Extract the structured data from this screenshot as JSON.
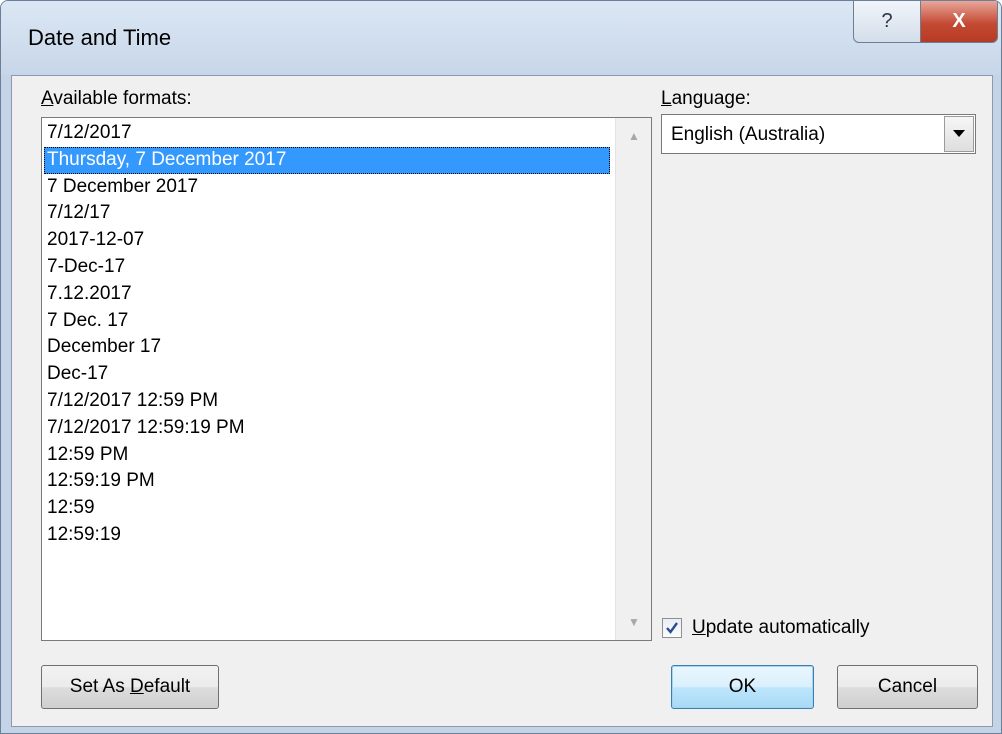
{
  "window": {
    "title": "Date and Time",
    "help_glyph": "?",
    "close_glyph": "X"
  },
  "formats": {
    "label_accel": "A",
    "label_rest": "vailable formats:",
    "selected_index": 1,
    "items": [
      "7/12/2017",
      "Thursday, 7 December 2017",
      "7 December 2017",
      "7/12/17",
      "2017-12-07",
      "7-Dec-17",
      "7.12.2017",
      "7 Dec. 17",
      "December 17",
      "Dec-17",
      "7/12/2017 12:59 PM",
      "7/12/2017 12:59:19 PM",
      "12:59 PM",
      "12:59:19 PM",
      "12:59",
      "12:59:19"
    ]
  },
  "language": {
    "label_accel": "L",
    "label_rest": "anguage:",
    "value": "English (Australia)"
  },
  "update": {
    "checked": true,
    "label_accel": "U",
    "label_rest": "pdate automatically"
  },
  "buttons": {
    "set_default_prefix": "Set As ",
    "set_default_accel": "D",
    "set_default_suffix": "efault",
    "ok": "OK",
    "cancel": "Cancel"
  },
  "colors": {
    "selection": "#3399ff",
    "close_button": "#c44a34",
    "frame": "#c4d3e6"
  }
}
